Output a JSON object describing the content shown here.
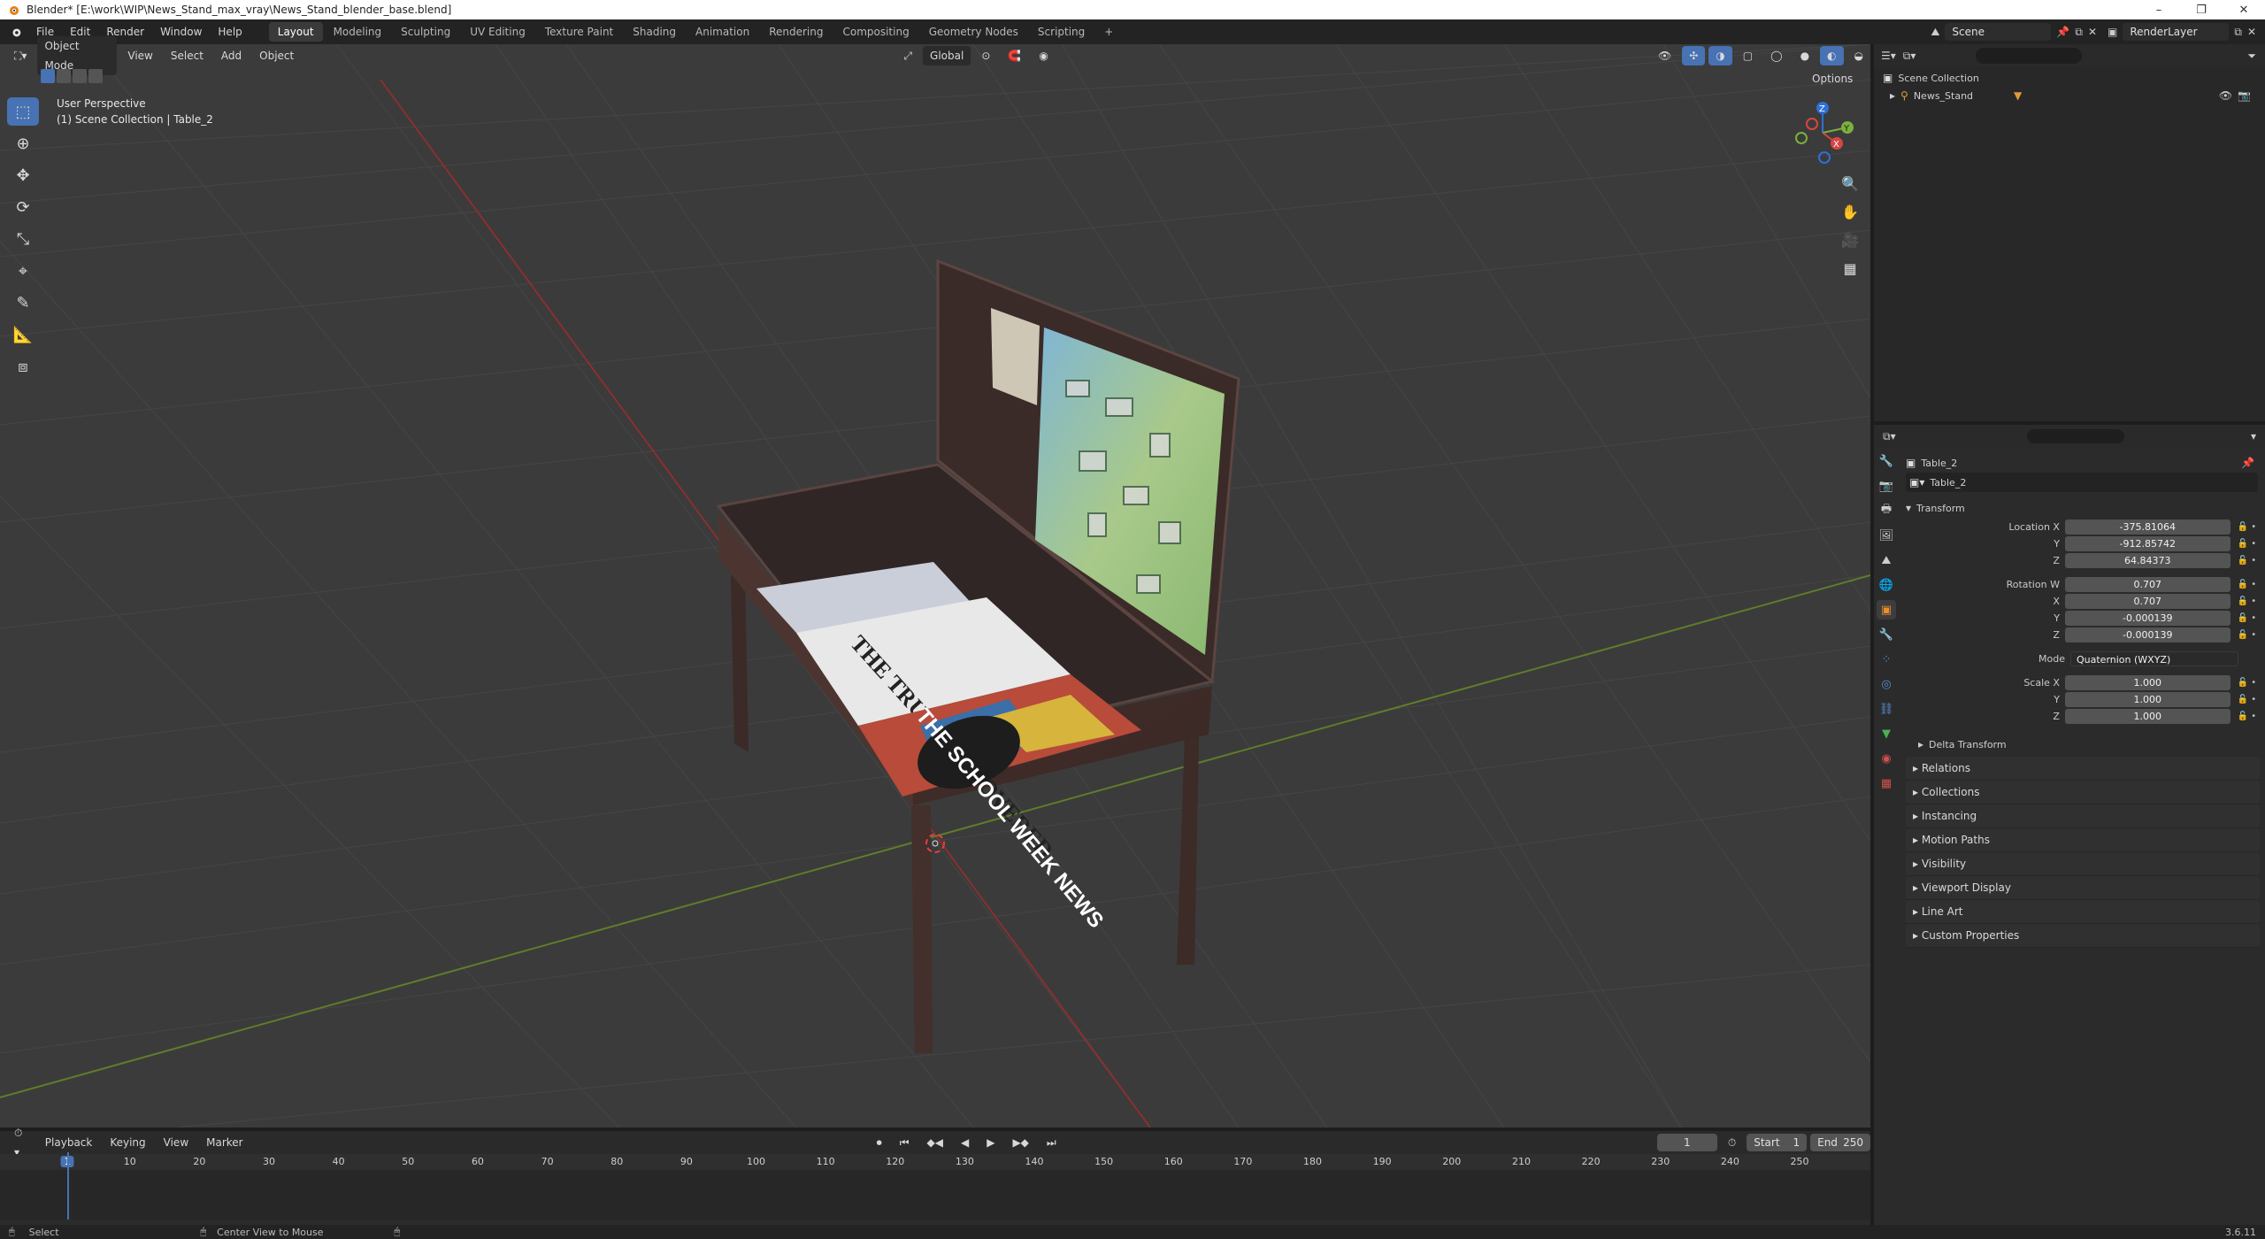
{
  "window": {
    "title": "Blender* [E:\\work\\WIP\\News_Stand_max_vray\\News_Stand_blender_base.blend]",
    "controls": [
      "–",
      "❐",
      "✕"
    ]
  },
  "menu": [
    "File",
    "Edit",
    "Render",
    "Window",
    "Help"
  ],
  "workspaces": [
    "Layout",
    "Modeling",
    "Sculpting",
    "UV Editing",
    "Texture Paint",
    "Shading",
    "Animation",
    "Rendering",
    "Compositing",
    "Geometry Nodes",
    "Scripting"
  ],
  "add_workspace": "+",
  "scene_field": "Scene",
  "render_layer_field": "RenderLayer",
  "viewport": {
    "mode": "Object Mode",
    "menus": [
      "View",
      "Select",
      "Add",
      "Object"
    ],
    "orientation": "Global",
    "options_label": "Options",
    "perspective_label": "User Perspective",
    "collection_label": "(1) Scene Collection | Table_2",
    "gizmo_axes": {
      "x": "X",
      "y": "Y",
      "z": "Z"
    }
  },
  "outliner": {
    "root": "Scene Collection",
    "items": [
      {
        "label": "News_Stand"
      }
    ]
  },
  "properties": {
    "object_name": "Table_2",
    "data_name": "Table_2",
    "transform_title": "Transform",
    "location_label": "Location X",
    "location": {
      "x": "-375.81064",
      "y": "-912.85742",
      "z": "64.84373"
    },
    "rotation_label": "Rotation W",
    "rotation": {
      "w": "0.707",
      "x": "0.707",
      "y": "-0.000139",
      "z": "-0.000139"
    },
    "mode_label": "Mode",
    "mode_value": "Quaternion (WXYZ)",
    "scale_label": "Scale X",
    "scale": {
      "x": "1.000",
      "y": "1.000",
      "z": "1.000"
    },
    "axis_y": "Y",
    "axis_z": "Z",
    "axis_x": "X",
    "delta_transform": "Delta Transform",
    "sections": [
      "Relations",
      "Collections",
      "Instancing",
      "Motion Paths",
      "Visibility",
      "Viewport Display",
      "Line Art",
      "Custom Properties"
    ]
  },
  "timeline": {
    "menus": [
      "Playback",
      "Keying",
      "View",
      "Marker"
    ],
    "current_frame": "1",
    "start_label": "Start",
    "start_value": "1",
    "end_label": "End",
    "end_value": "250",
    "ticks": [
      "1",
      "10",
      "20",
      "30",
      "40",
      "50",
      "60",
      "70",
      "80",
      "90",
      "100",
      "110",
      "120",
      "130",
      "140",
      "150",
      "160",
      "170",
      "180",
      "190",
      "200",
      "210",
      "220",
      "230",
      "240",
      "250"
    ]
  },
  "statusbar": {
    "select": "Select",
    "center_view": "Center View to Mouse",
    "version": "3.6.11"
  },
  "newspaper": {
    "headline_1": "THE TRUTH UNCOVERED",
    "headline_2": "THE SCHOOL WEEK NEWS"
  }
}
